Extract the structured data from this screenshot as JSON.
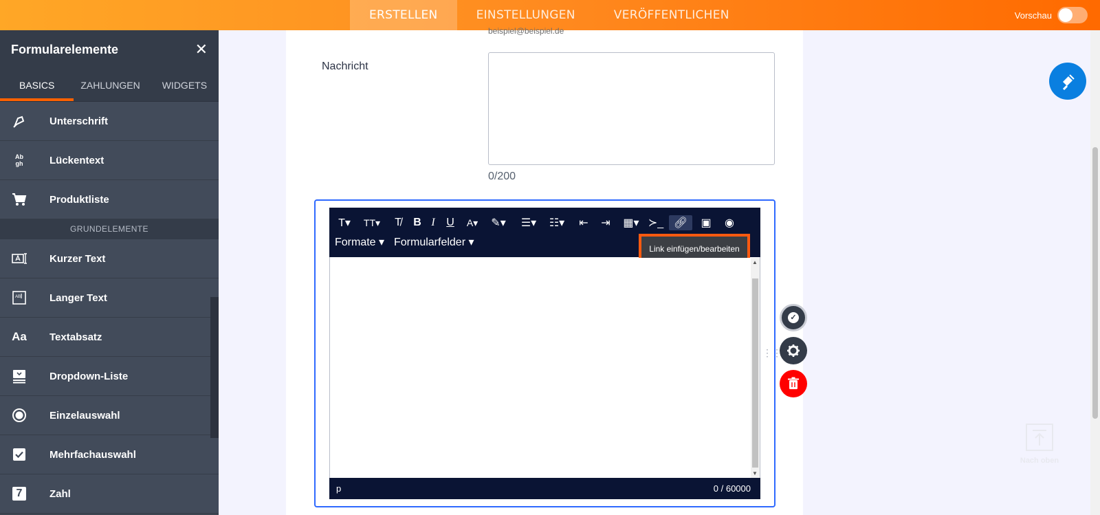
{
  "topbar": {
    "tabs": [
      {
        "label": "ERSTELLEN",
        "active": true
      },
      {
        "label": "EINSTELLUNGEN",
        "active": false
      },
      {
        "label": "VERÖFFENTLICHEN",
        "active": false
      }
    ],
    "preview_label": "Vorschau"
  },
  "sidebar": {
    "title": "Formularelemente",
    "tabs": [
      {
        "label": "BASICS",
        "active": true
      },
      {
        "label": "ZAHLUNGEN",
        "active": false
      },
      {
        "label": "WIDGETS",
        "active": false
      }
    ],
    "items_top": [
      {
        "label": "Unterschrift",
        "icon": "pen-icon"
      },
      {
        "label": "Lückentext",
        "icon": "fill-blank-icon"
      },
      {
        "label": "Produktliste",
        "icon": "cart-icon"
      }
    ],
    "section_label": "GRUNDELEMENTE",
    "items": [
      {
        "label": "Kurzer Text",
        "icon": "short-text-icon"
      },
      {
        "label": "Langer Text",
        "icon": "long-text-icon"
      },
      {
        "label": "Textabsatz",
        "icon": "paragraph-icon",
        "glyph": "Aa"
      },
      {
        "label": "Dropdown-Liste",
        "icon": "dropdown-icon"
      },
      {
        "label": "Einzelauswahl",
        "icon": "radio-icon"
      },
      {
        "label": "Mehrfachauswahl",
        "icon": "checkbox-icon"
      },
      {
        "label": "Zahl",
        "icon": "number-icon",
        "glyph": "7"
      }
    ],
    "fill_blank_glyph_top": "Ab",
    "fill_blank_glyph_bottom": "gh"
  },
  "form": {
    "email_hint": "beispiel@beispiel.de",
    "message_label": "Nachricht",
    "message_counter": "0/200",
    "editor": {
      "menu_formats": "Formate",
      "menu_fields": "Formularfelder",
      "tooltip": "Link einfügen/bearbeiten",
      "status_path": "p",
      "char_count": "0 / 60000"
    }
  },
  "back_to_top_label": "Nach oben",
  "colors": {
    "accent": "#ff6100",
    "sidebar_bg": "#3e4652",
    "editor_bar": "#0a1434",
    "field_border": "#2e69ff",
    "delete_red": "#ff0000",
    "fab_blue": "#0a7fe0"
  }
}
